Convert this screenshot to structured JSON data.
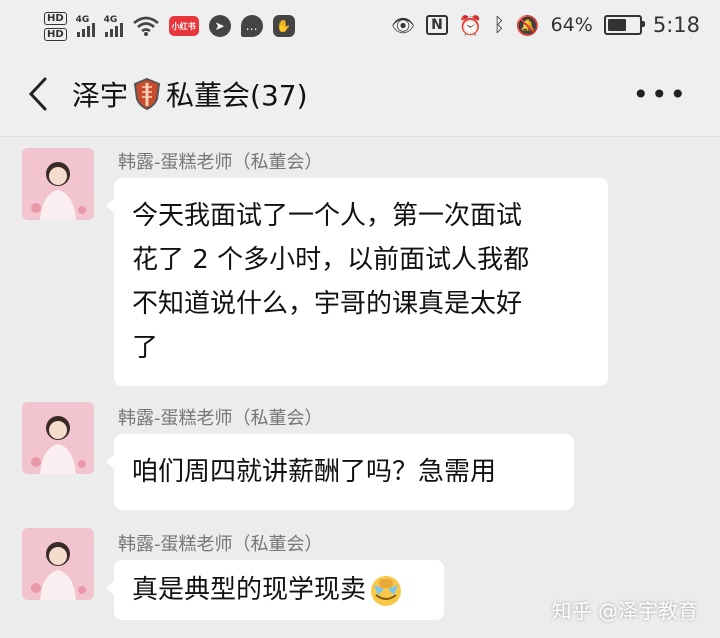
{
  "status_bar": {
    "hd1": "HD",
    "hd2": "HD",
    "signal1_label": "4G",
    "signal2_label": "4G",
    "app_badge": "小红书",
    "battery_percent": "64%",
    "battery_level": 0.64,
    "time": "5:18",
    "icons": [
      "wifi-icon",
      "xiaohongshu-app-icon",
      "navigation-app-icon",
      "chat-app-icon",
      "hand-app-icon",
      "eye-icon",
      "nfc-icon",
      "alarm-icon",
      "bluetooth-icon",
      "mute-icon",
      "battery-icon"
    ]
  },
  "header": {
    "back_icon": "chevron-left-icon",
    "title_prefix": "泽宇",
    "title_suffix": "私董会(37)",
    "more_icon": "more-dots-icon"
  },
  "messages": [
    {
      "sender": "韩露-蛋糕老师（私董会）",
      "lines": [
        "今天我面试了一个人，第一次面试",
        "花了 2 个多小时，以前面试人我都",
        "不知道说什么，宇哥的课真是太好",
        "了"
      ]
    },
    {
      "sender": "韩露-蛋糕老师（私董会）",
      "lines": [
        "咱们周四就讲薪酬了吗？急需用"
      ]
    },
    {
      "sender": "韩露-蛋糕老师（私董会）",
      "lines": [
        "真是典型的现学现卖"
      ]
    }
  ],
  "watermark": "知乎 @泽宇教育",
  "colors": {
    "background": "#ececec",
    "bubble": "#ffffff",
    "badge": "#e8373c"
  }
}
